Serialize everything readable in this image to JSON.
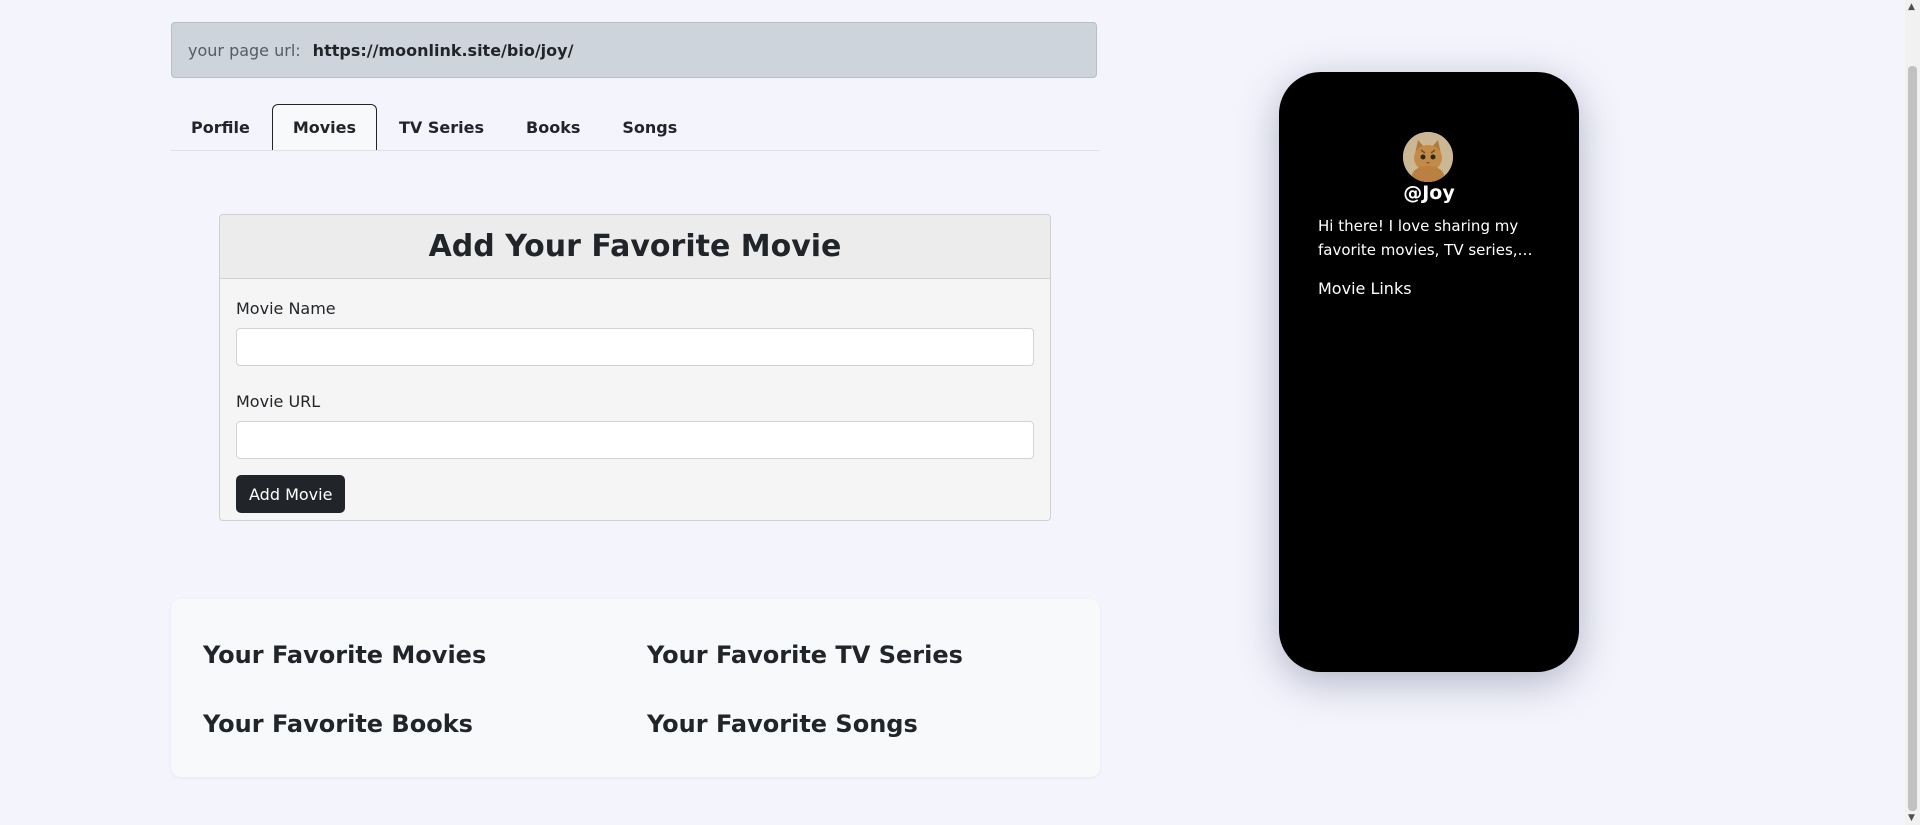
{
  "url_bar": {
    "label": "your page url:",
    "value": "https://moonlink.site/bio/joy/"
  },
  "tabs": [
    {
      "label": "Porfile",
      "active": false
    },
    {
      "label": "Movies",
      "active": true
    },
    {
      "label": "TV Series",
      "active": false
    },
    {
      "label": "Books",
      "active": false
    },
    {
      "label": "Songs",
      "active": false
    }
  ],
  "form": {
    "title": "Add Your Favorite Movie",
    "name_label": "Movie Name",
    "name_value": "",
    "url_label": "Movie URL",
    "url_value": "",
    "submit_label": "Add Movie"
  },
  "favorites": {
    "movies": "Your Favorite Movies",
    "tv_series": "Your Favorite TV Series",
    "books": "Your Favorite Books",
    "songs": "Your Favorite Songs"
  },
  "preview": {
    "handle": "@Joy",
    "bio": "Hi there! I love sharing my favorite movies, TV series,…",
    "links_title": "Movie Links",
    "avatar_icon": "cat-avatar-icon"
  },
  "colors": {
    "background": "#f3f4fc",
    "phone": "#000000",
    "button": "#212529"
  }
}
